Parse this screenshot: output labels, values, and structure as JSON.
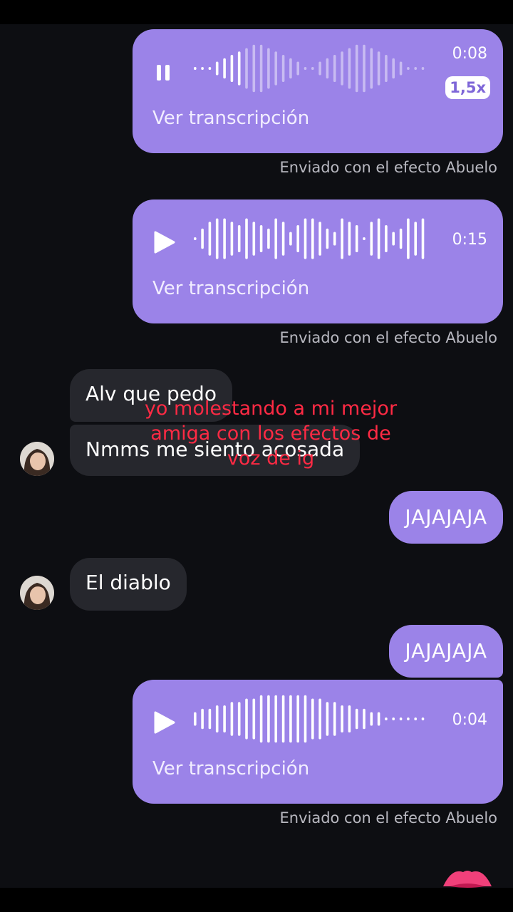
{
  "voice_messages": [
    {
      "duration": "0:08",
      "speed": "1,5x",
      "transcript_label": "Ver transcripción",
      "status": "Enviado con el efecto Abuelo",
      "state": "playing",
      "control_icon": "pause-icon"
    },
    {
      "duration": "0:15",
      "transcript_label": "Ver transcripción",
      "status": "Enviado con el efecto Abuelo",
      "state": "paused",
      "control_icon": "play-icon"
    },
    {
      "duration": "0:04",
      "transcript_label": "Ver transcripción",
      "status": "Enviado con el efecto Abuelo",
      "state": "paused",
      "control_icon": "play-icon"
    }
  ],
  "incoming": [
    {
      "text": "Alv que pedo"
    },
    {
      "text": "Nmms me siento acosada"
    },
    {
      "text": "El diablo"
    }
  ],
  "outgoing": [
    {
      "text": "JAJAJAJA"
    },
    {
      "text": "JAJAJAJA"
    }
  ],
  "overlay_caption": "yo molestando a mi mejor amiga con los efectos de voz de ig",
  "colors": {
    "background": "#0d0e12",
    "sent_bubble": "#9b83e8",
    "received_bubble": "#26272d",
    "caption": "#ff2a44"
  }
}
